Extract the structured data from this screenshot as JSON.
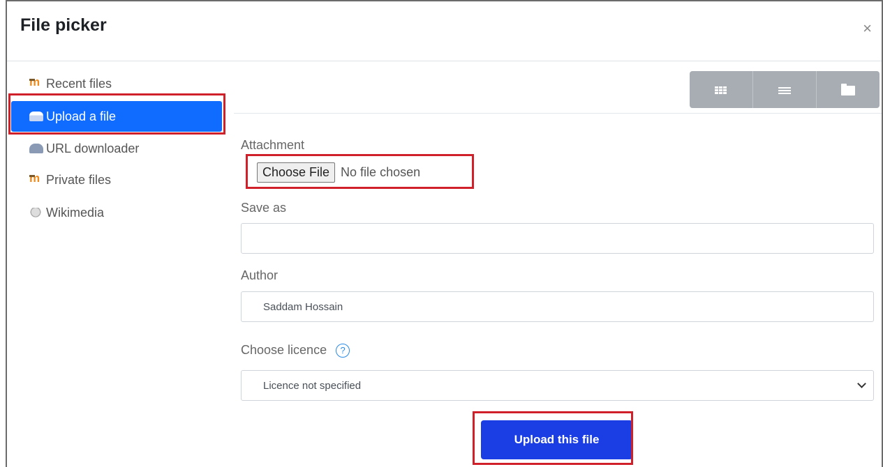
{
  "dialog": {
    "title": "File picker",
    "close_glyph": "×"
  },
  "sidebar": {
    "items": [
      {
        "label": "Recent files",
        "icon": "moodle-icon"
      },
      {
        "label": "Upload a file",
        "icon": "upload-icon",
        "active": true
      },
      {
        "label": "URL downloader",
        "icon": "url-downloader-icon"
      },
      {
        "label": "Private files",
        "icon": "moodle-icon"
      },
      {
        "label": "Wikimedia",
        "icon": "wikimedia-icon"
      }
    ]
  },
  "toolbar": {
    "buttons": [
      "grid-view-icon",
      "list-view-icon",
      "folder-view-icon"
    ]
  },
  "form": {
    "attachment_label": "Attachment",
    "choose_file_label": "Choose File",
    "no_file_text": "No file chosen",
    "save_as_label": "Save as",
    "save_as_value": "",
    "author_label": "Author",
    "author_value": "Saddam Hossain",
    "licence_label": "Choose licence",
    "licence_help_glyph": "?",
    "licence_value": "Licence not specified",
    "submit_label": "Upload this file"
  },
  "colors": {
    "active_nav": "#0f6cff",
    "submit_button": "#1a3de4",
    "highlight_border": "#d0202a"
  }
}
